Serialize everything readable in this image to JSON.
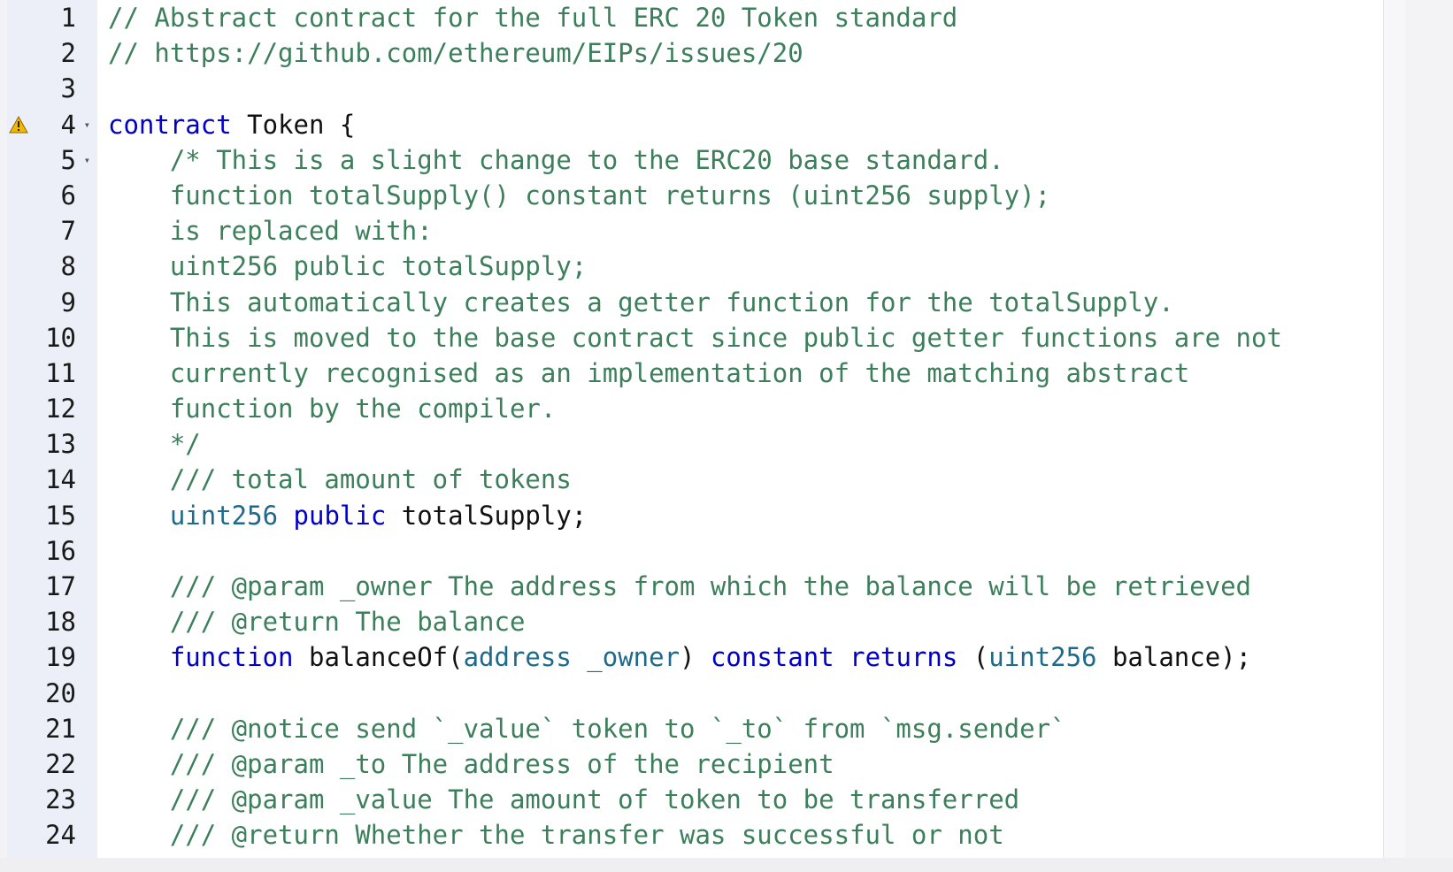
{
  "editor": {
    "colors": {
      "comment": "#3c7f5b",
      "keyword": "#0000c8",
      "type": "#1e6a8c",
      "text": "#111111",
      "gutter_bg": "#eceff8",
      "warning": "#f2b705"
    },
    "warning_line": 4,
    "fold_lines": [
      4,
      5
    ],
    "icons": {
      "warning": "warning-triangle-icon",
      "fold": "fold-arrow-icon"
    },
    "lines": [
      {
        "n": "1",
        "tokens": [
          {
            "t": "// Abstract contract for the full ERC 20 Token standard",
            "k": "comment"
          }
        ]
      },
      {
        "n": "2",
        "tokens": [
          {
            "t": "// https://github.com/ethereum/EIPs/issues/20",
            "k": "comment"
          }
        ]
      },
      {
        "n": "3",
        "tokens": []
      },
      {
        "n": "4",
        "tokens": [
          {
            "t": "contract",
            "k": "keyword"
          },
          {
            "t": " Token {",
            "k": "text"
          }
        ]
      },
      {
        "n": "5",
        "tokens": [
          {
            "t": "    /* This is a slight change to the ERC20 base standard.",
            "k": "comment"
          }
        ]
      },
      {
        "n": "6",
        "tokens": [
          {
            "t": "    function totalSupply() constant returns (uint256 supply);",
            "k": "comment"
          }
        ]
      },
      {
        "n": "7",
        "tokens": [
          {
            "t": "    is replaced with:",
            "k": "comment"
          }
        ]
      },
      {
        "n": "8",
        "tokens": [
          {
            "t": "    uint256 public totalSupply;",
            "k": "comment"
          }
        ]
      },
      {
        "n": "9",
        "tokens": [
          {
            "t": "    This automatically creates a getter function for the totalSupply.",
            "k": "comment"
          }
        ]
      },
      {
        "n": "10",
        "tokens": [
          {
            "t": "    This is moved to the base contract since public getter functions are not",
            "k": "comment"
          }
        ]
      },
      {
        "n": "11",
        "tokens": [
          {
            "t": "    currently recognised as an implementation of the matching abstract",
            "k": "comment"
          }
        ]
      },
      {
        "n": "12",
        "tokens": [
          {
            "t": "    function by the compiler.",
            "k": "comment"
          }
        ]
      },
      {
        "n": "13",
        "tokens": [
          {
            "t": "    */",
            "k": "comment"
          }
        ]
      },
      {
        "n": "14",
        "tokens": [
          {
            "t": "    /// total amount of tokens",
            "k": "comment"
          }
        ]
      },
      {
        "n": "15",
        "tokens": [
          {
            "t": "    ",
            "k": "text"
          },
          {
            "t": "uint256",
            "k": "type"
          },
          {
            "t": " ",
            "k": "text"
          },
          {
            "t": "public",
            "k": "keyword"
          },
          {
            "t": " totalSupply;",
            "k": "text"
          }
        ]
      },
      {
        "n": "16",
        "tokens": []
      },
      {
        "n": "17",
        "tokens": [
          {
            "t": "    /// @param _owner The address from which the balance will be retrieved",
            "k": "comment"
          }
        ]
      },
      {
        "n": "18",
        "tokens": [
          {
            "t": "    /// @return The balance",
            "k": "comment"
          }
        ]
      },
      {
        "n": "19",
        "tokens": [
          {
            "t": "    ",
            "k": "text"
          },
          {
            "t": "function",
            "k": "keyword"
          },
          {
            "t": " balanceOf(",
            "k": "text"
          },
          {
            "t": "address",
            "k": "type"
          },
          {
            "t": " ",
            "k": "text"
          },
          {
            "t": "_owner",
            "k": "type"
          },
          {
            "t": ") ",
            "k": "text"
          },
          {
            "t": "constant",
            "k": "keyword"
          },
          {
            "t": " ",
            "k": "text"
          },
          {
            "t": "returns",
            "k": "keyword"
          },
          {
            "t": " (",
            "k": "text"
          },
          {
            "t": "uint256",
            "k": "type"
          },
          {
            "t": " balance);",
            "k": "text"
          }
        ]
      },
      {
        "n": "20",
        "tokens": []
      },
      {
        "n": "21",
        "tokens": [
          {
            "t": "    /// @notice send `_value` token to `_to` from `msg.sender`",
            "k": "comment"
          }
        ]
      },
      {
        "n": "22",
        "tokens": [
          {
            "t": "    /// @param _to The address of the recipient",
            "k": "comment"
          }
        ]
      },
      {
        "n": "23",
        "tokens": [
          {
            "t": "    /// @param _value The amount of token to be transferred",
            "k": "comment"
          }
        ]
      },
      {
        "n": "24",
        "tokens": [
          {
            "t": "    /// @return Whether the transfer was successful or not",
            "k": "comment"
          }
        ]
      }
    ]
  }
}
